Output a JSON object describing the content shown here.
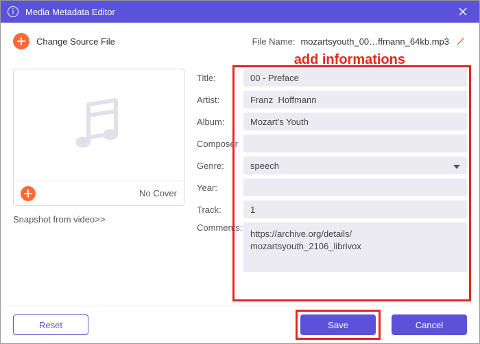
{
  "titlebar": {
    "title": "Media Metadata Editor"
  },
  "source": {
    "change_label": "Change Source File",
    "file_name_label": "File Name:",
    "file_name_value": "mozartsyouth_00…ffmann_64kb.mp3"
  },
  "callout": "add informations",
  "cover": {
    "no_cover_label": "No Cover",
    "snapshot_label": "Snapshot from video>>"
  },
  "form": {
    "labels": {
      "title": "Title:",
      "artist": "Artist:",
      "album": "Album:",
      "composer": "Composer",
      "genre": "Genre:",
      "year": "Year:",
      "track": "Track:",
      "comments": "Comments:"
    },
    "values": {
      "title": "00 - Preface",
      "artist": "Franz  Hoffmann",
      "album": "Mozart's Youth",
      "composer": "",
      "genre": "speech",
      "year": "",
      "track": "1",
      "comments": "https://archive.org/details/\nmozartsyouth_2106_librivox"
    }
  },
  "footer": {
    "reset": "Reset",
    "save": "Save",
    "cancel": "Cancel"
  }
}
